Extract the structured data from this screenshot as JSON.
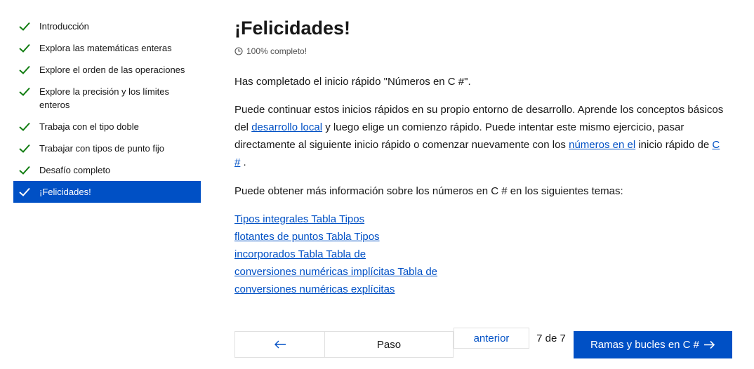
{
  "sidebar": {
    "items": [
      {
        "label": "Introducción"
      },
      {
        "label": "Explora las matemáticas enteras"
      },
      {
        "label": "Explore el orden de las operaciones"
      },
      {
        "label": "Explore la precisión y los límites enteros"
      },
      {
        "label": "Trabaja con el tipo doble"
      },
      {
        "label": "Trabajar con tipos de punto fijo"
      },
      {
        "label": "Desafío completo"
      },
      {
        "label": "¡Felicidades!"
      }
    ]
  },
  "main": {
    "title": "¡Felicidades!",
    "progress_text": "100% completo!",
    "paragraph1": "Has completado el inicio rápido \"Números en C #\".",
    "paragraph2": {
      "part1": "Puede continuar estos inicios rápidos en su propio entorno de desarrollo. Aprende los conceptos básicos del ",
      "link1": "desarrollo local",
      "part2": " y luego elige un comienzo rápido. Puede intentar este mismo ejercicio, pasar directamente al siguiente inicio rápido o comenzar nuevamente con los ",
      "link2": "números en el",
      "part3": " inicio rápido de ",
      "link3": "C #",
      "part4": " ."
    },
    "paragraph3": "Puede obtener más información sobre los números en C # en los siguientes temas:",
    "links": [
      "Tipos integrales Tabla Tipos ",
      "flotantes de puntos Tabla Tipos ",
      "incorporados Tabla Tabla de ",
      "conversiones numéricas implícitas Tabla de ",
      "conversiones numéricas explícitas"
    ]
  },
  "nav": {
    "step_label": "Paso",
    "anterior_label": "anterior",
    "count": "7 de 7",
    "next_label": "Ramas y bucles en C #"
  },
  "colors": {
    "accent": "#0050c5",
    "check": "#107c10"
  }
}
